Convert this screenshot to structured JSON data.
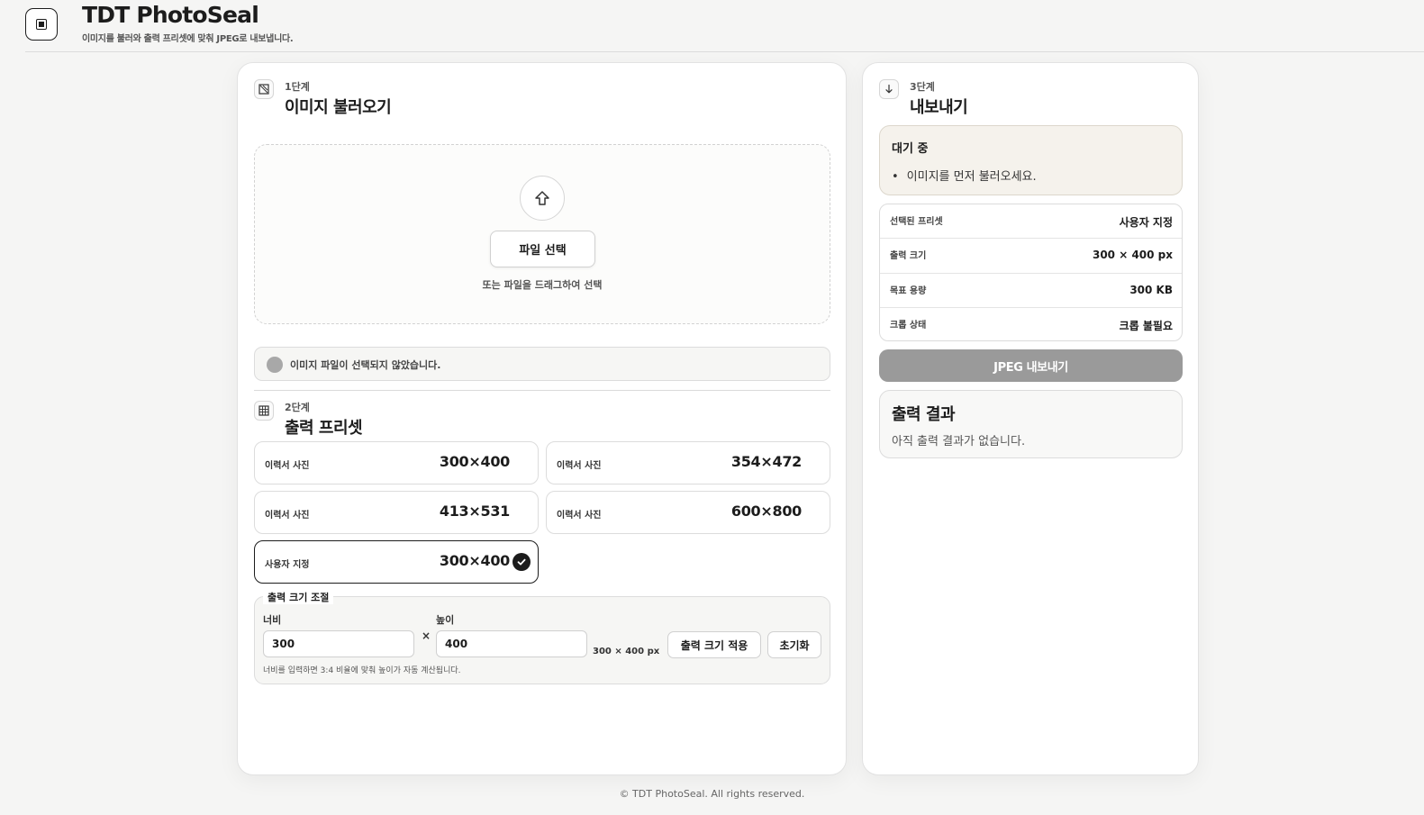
{
  "header": {
    "title": "TDT PhotoSeal",
    "subtitle": "이미지를 불러와 출력 프리셋에 맞춰 JPEG로 내보냅니다."
  },
  "step1": {
    "label": "1단계",
    "title": "이미지 불러오기",
    "file_button": "파일 선택",
    "drop_hint": "또는 파일을 드래그하여 선택",
    "status": "이미지 파일이 선택되지 않았습니다."
  },
  "step2": {
    "label": "2단계",
    "title": "출력 프리셋",
    "presets": [
      {
        "label": "이력서 사진",
        "size": "300×400",
        "selected": false
      },
      {
        "label": "이력서 사진",
        "size": "354×472",
        "selected": false
      },
      {
        "label": "이력서 사진",
        "size": "413×531",
        "selected": false
      },
      {
        "label": "이력서 사진",
        "size": "600×800",
        "selected": false
      },
      {
        "label": "사용자 지정",
        "size": "300×400",
        "selected": true
      }
    ],
    "adjust": {
      "legend": "출력 크기 조절",
      "width_label": "너비",
      "width_value": "300",
      "height_label": "높이",
      "height_value": "400",
      "times": "×",
      "readout": "300 × 400 px",
      "apply_button": "출력 크기 적용",
      "reset_button": "초기화",
      "hint": "너비를 입력하면 3:4 비율에 맞춰 높이가 자동 계산됩니다."
    }
  },
  "step3": {
    "label": "3단계",
    "title": "내보내기",
    "waiting_title": "대기 중",
    "waiting_item": "이미지를 먼저 불러오세요.",
    "info": [
      {
        "key": "선택된 프리셋",
        "value": "사용자 지정"
      },
      {
        "key": "출력 크기",
        "value": "300 × 400 px"
      },
      {
        "key": "목표 용량",
        "value": "300 KB"
      },
      {
        "key": "크롭 상태",
        "value": "크롭 불필요"
      }
    ],
    "export_button": "JPEG 내보내기",
    "result_title": "출력 결과",
    "result_text": "아직 출력 결과가 없습니다."
  },
  "footer": "© TDT PhotoSeal. All rights reserved.",
  "colors": {
    "accent": "#1c1c1c",
    "disabled_button": "#9a9a9a",
    "waiting_bg": "#f5f2ec"
  }
}
